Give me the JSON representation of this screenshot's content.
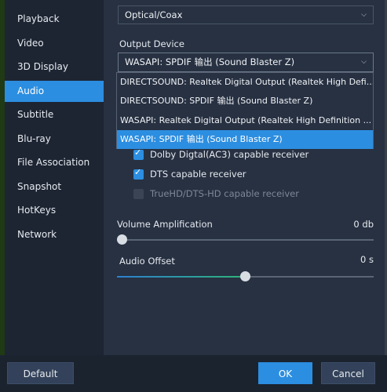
{
  "sidebar": {
    "items": [
      {
        "label": "Playback"
      },
      {
        "label": "Video"
      },
      {
        "label": "3D Display"
      },
      {
        "label": "Audio"
      },
      {
        "label": "Subtitle"
      },
      {
        "label": "Blu-ray"
      },
      {
        "label": "File Association"
      },
      {
        "label": "Snapshot"
      },
      {
        "label": "HotKeys"
      },
      {
        "label": "Network"
      }
    ],
    "active_index": 3
  },
  "audio": {
    "output_mode": "Optical/Coax",
    "output_device_label": "Output Device",
    "output_device_value": "WASAPI: SPDIF 输出 (Sound Blaster Z)",
    "device_options": [
      "DIRECTSOUND: Realtek Digital Output (Realtek High Defi...",
      "DIRECTSOUND: SPDIF 输出 (Sound Blaster Z)",
      "WASAPI: Realtek Digital Output (Realtek High Definition ...",
      "WASAPI: SPDIF 输出 (Sound Blaster Z)"
    ],
    "checkboxes": [
      {
        "label": "Dolby Digtal(AC3) capable receiver",
        "checked": true,
        "enabled": true
      },
      {
        "label": "DTS capable receiver",
        "checked": true,
        "enabled": true
      },
      {
        "label": "TrueHD/DTS-HD capable receiver",
        "checked": false,
        "enabled": false
      }
    ],
    "volume_label": "Volume Amplification",
    "volume_value": "0 db",
    "volume_level": 0.0,
    "offset_label": "Audio Offset",
    "offset_value": "0 s",
    "offset_level": 0.5
  },
  "footer": {
    "default_label": "Default",
    "ok_label": "OK",
    "cancel_label": "Cancel"
  },
  "colors": {
    "accent": "#2c8ee0",
    "panel": "#273142",
    "sidebar": "#1d2533"
  },
  "icons": {
    "dropdown": "chevron-down-icon",
    "check": "checkmark-icon"
  }
}
